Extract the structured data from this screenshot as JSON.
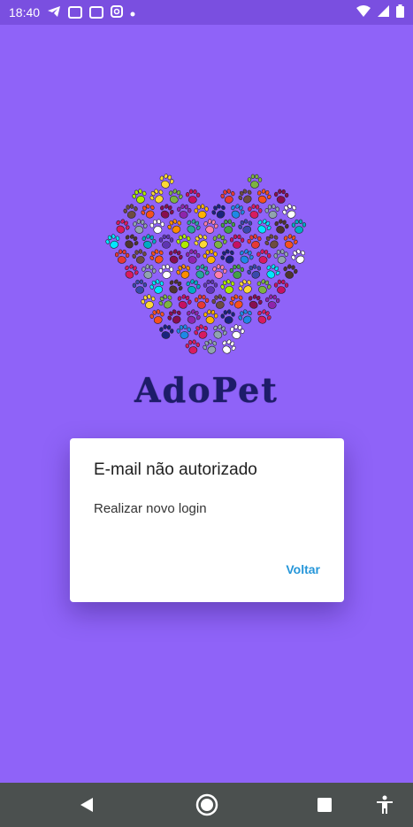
{
  "status": {
    "time": "18:40",
    "icons_left": [
      "telegram-icon",
      "bag-icon",
      "bag-icon",
      "instagram-icon",
      "dot-icon"
    ],
    "icons_right": [
      "wifi-icon",
      "signal-icon",
      "battery-icon"
    ]
  },
  "app": {
    "name": "AdoPet",
    "background_color": "#8f63f8"
  },
  "dialog": {
    "title": "E-mail não autorizado",
    "message": "Realizar novo login",
    "button_label": "Voltar",
    "button_color": "#2596d9"
  },
  "navbar": {
    "buttons": [
      "back-icon",
      "home-icon",
      "recents-icon",
      "accessibility-icon"
    ]
  }
}
